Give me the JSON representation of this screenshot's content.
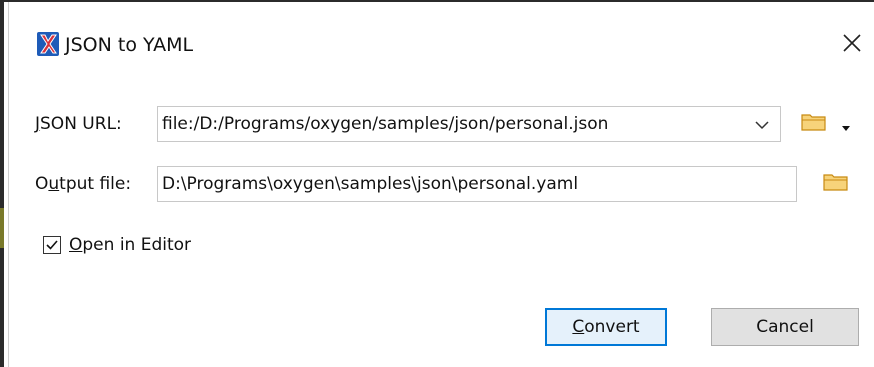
{
  "dialog": {
    "title": "JSON to YAML",
    "app_icon": "oxygen-x-icon",
    "close_icon": "close-icon"
  },
  "json_url": {
    "label_pre": "",
    "label_mnemonic": "J",
    "label_post": "SON URL:",
    "value": "file:/D:/Programs/oxygen/samples/json/personal.json",
    "dropdown_icon": "chevron-down-icon",
    "browse_icon": "folder-icon",
    "browse_menu_icon": "caret-down-icon"
  },
  "output_file": {
    "label_pre": "O",
    "label_mnemonic": "u",
    "label_post": "tput file:",
    "value": "D:\\Programs\\oxygen\\samples\\json\\personal.yaml",
    "browse_icon": "folder-icon"
  },
  "open_in_editor": {
    "label_mnemonic": "O",
    "label_post": "pen in Editor",
    "checked": true
  },
  "buttons": {
    "convert_mnemonic": "C",
    "convert_post": "onvert",
    "cancel": "Cancel"
  },
  "colors": {
    "accent": "#0078d7",
    "folder": "#e8b23a",
    "icon_red": "#d8323c",
    "icon_blue": "#1e5bb8"
  }
}
